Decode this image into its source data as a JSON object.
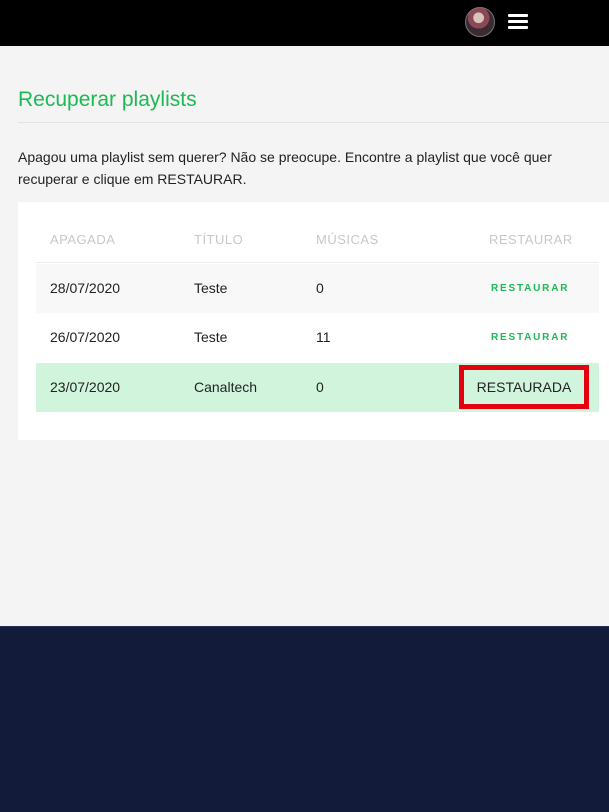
{
  "header": {
    "avatar_icon": "user-avatar",
    "menu_icon": "hamburger-menu-icon"
  },
  "page": {
    "title": "Recuperar playlists",
    "intro": "Apagou uma playlist sem querer? Não se preocupe. Encontre a playlist que você quer recuperar e clique em RESTAURAR."
  },
  "table": {
    "headers": {
      "deleted": "APAGADA",
      "title": "TÍTULO",
      "songs": "MÚSICAS",
      "restore": "RESTAURAR"
    },
    "rows": [
      {
        "date": "28/07/2020",
        "title": "Teste",
        "songs": "0",
        "action": "RESTAURAR"
      },
      {
        "date": "26/07/2020",
        "title": "Teste",
        "songs": "11",
        "action": "RESTAURAR"
      },
      {
        "date": "23/07/2020",
        "title": "Canaltech",
        "songs": "0",
        "action": "RESTAURADA"
      }
    ]
  },
  "colors": {
    "accent": "#1db954",
    "restored_row": "#d1f5dc",
    "highlight_box": "#e3000f",
    "footer": "#121b3a"
  }
}
